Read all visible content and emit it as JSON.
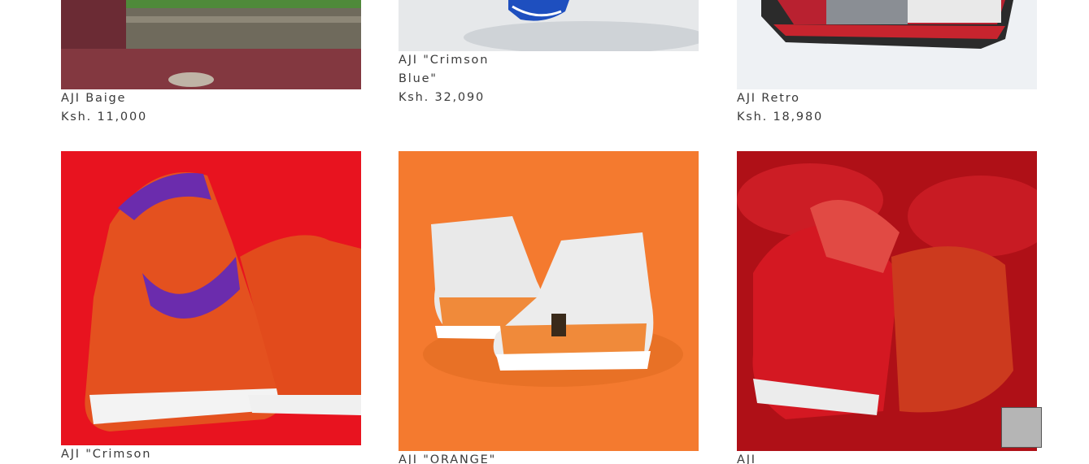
{
  "products": [
    {
      "title": "AJI Baige",
      "price": "Ksh. 11,000",
      "image": "shoe-photo-baige",
      "bg": "#7a2f3a"
    },
    {
      "title": "AJI \"Crimson Blue\"",
      "price": "Ksh. 32,090",
      "image": "shoe-photo-crimson-blue",
      "bg": "#e9ecef"
    },
    {
      "title": "AJI Retro",
      "price": "Ksh. 18,980",
      "image": "shoe-photo-retro",
      "bg": "#eef1f4"
    },
    {
      "title": "AJI \"Crimson",
      "price": "",
      "image": "shoe-photo-crimson",
      "bg": "#e8131f"
    },
    {
      "title": "AJI \"ORANGE\"",
      "price": "",
      "image": "shoe-photo-orange",
      "bg": "#f47a2f"
    },
    {
      "title": "AJI",
      "price": "",
      "image": "shoe-photo-red-fur",
      "bg": "#c0121a"
    }
  ],
  "scroll_top": {
    "icon": "scroll-to-top-icon",
    "color": "#b5b5b5"
  }
}
